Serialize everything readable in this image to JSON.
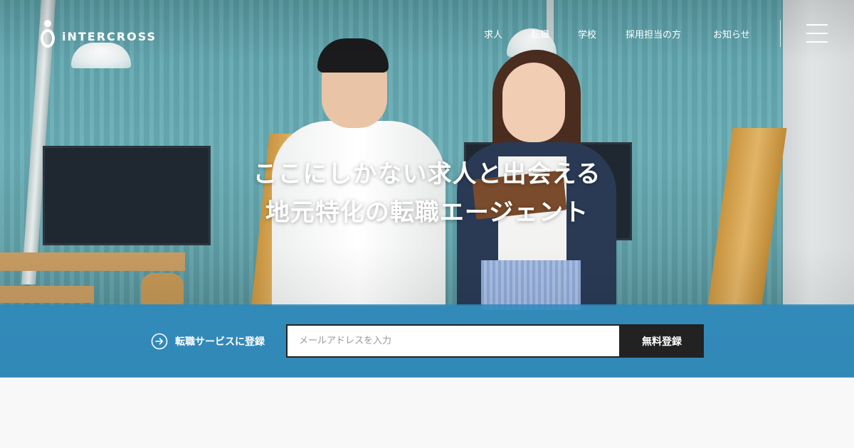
{
  "header": {
    "logo_text": "iNTERCROSS",
    "nav": [
      {
        "label": "求人"
      },
      {
        "label": "転職"
      },
      {
        "label": "学校"
      },
      {
        "label": "採用担当の方"
      },
      {
        "label": "お知らせ"
      }
    ],
    "menu_icon": "hamburger-icon"
  },
  "hero": {
    "headline_line1": "ここにしかない求人と出会える",
    "headline_line2": "地元特化の転職エージェント"
  },
  "register": {
    "label": "転職サービスに登録",
    "label_icon": "arrow-right-circle-icon",
    "email_placeholder": "メールアドレスを入力",
    "email_value": "",
    "submit_label": "無料登録"
  },
  "colors": {
    "band": "#2c88be",
    "button": "#222222",
    "text_on_dark": "#ffffff"
  }
}
